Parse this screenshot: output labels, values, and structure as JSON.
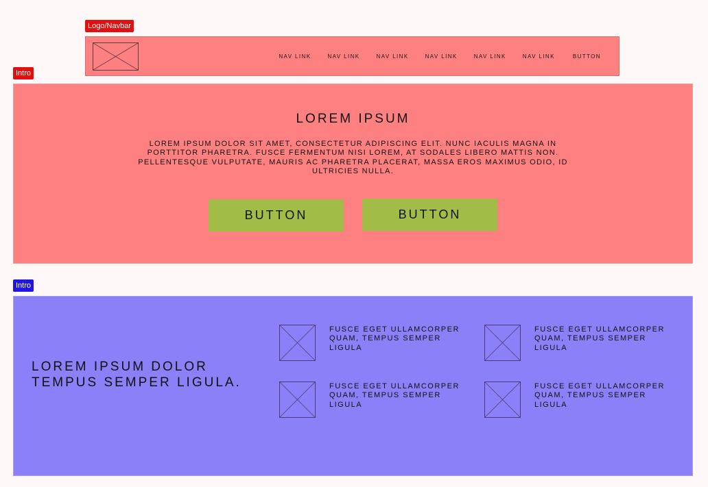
{
  "labels": {
    "navbar_tag": "Logo/Navbar",
    "intro_tag_1": "Intro",
    "intro_tag_2": "Intro"
  },
  "navbar": {
    "logo_icon": "placeholder-image-icon",
    "links": [
      "NAV LINK",
      "NAV LINK",
      "NAV LINK",
      "NAV LINK",
      "NAV LINK",
      "NAV LINK"
    ],
    "button_label": "BUTTON"
  },
  "intro": {
    "title": "LOREM IPSUM",
    "body": "LOREM IPSUM DOLOR SIT AMET, CONSECTETUR ADIPISCING ELIT. NUNC IACULIS MAGNA IN PORTTITOR PHARETRA. FUSCE FERMENTUM NISI LOREM, AT SODALES LIBERO MATTIS NON. PELLENTESQUE VULPUTATE, MAURIS AC PHARETRA PLACERAT, MASSA EROS MAXIMUS ODIO, ID ULTRICIES NULLA.",
    "buttons": [
      "BUTTON",
      "BUTTON"
    ]
  },
  "features_section": {
    "heading": "LOREM IPSUM DOLOR TEMPUS SEMPER LIGULA.",
    "items": [
      {
        "icon": "placeholder-image-icon",
        "text": "FUSCE EGET ULLAMCORPER QUAM, TEMPUS SEMPER LIGULA"
      },
      {
        "icon": "placeholder-image-icon",
        "text": "FUSCE EGET ULLAMCORPER QUAM, TEMPUS SEMPER LIGULA"
      },
      {
        "icon": "placeholder-image-icon",
        "text": "FUSCE EGET ULLAMCORPER QUAM, TEMPUS SEMPER LIGULA"
      },
      {
        "icon": "placeholder-image-icon",
        "text": "FUSCE EGET ULLAMCORPER QUAM, TEMPUS SEMPER LIGULA"
      }
    ]
  },
  "colors": {
    "tag_red": "#e01010",
    "tag_blue": "#2215e0",
    "section_red": "#ff8080",
    "section_blue": "#8c80f8",
    "button_green": "#a1bd48",
    "page_background": "#fff8f8"
  }
}
